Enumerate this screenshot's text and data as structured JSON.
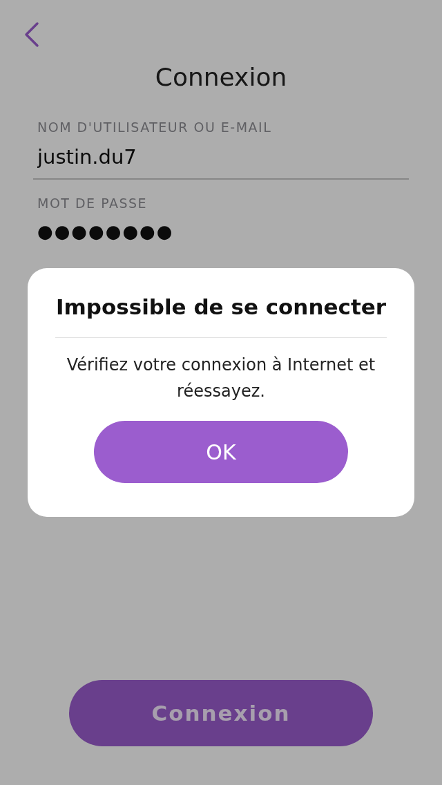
{
  "header": {
    "title": "Connexion"
  },
  "fields": [
    {
      "kind": "text",
      "label": "NOM D'UTILISATEUR OU E-MAIL",
      "value": "justin.du7"
    },
    {
      "kind": "password",
      "label": "MOT DE PASSE",
      "value": "●●●●●●●●"
    }
  ],
  "submit_button": {
    "label": "Connexion"
  },
  "alert": {
    "title": "Impossible de se connecter",
    "message": "Vérifiez votre connexion à Internet et réessayez.",
    "button": "OK"
  }
}
